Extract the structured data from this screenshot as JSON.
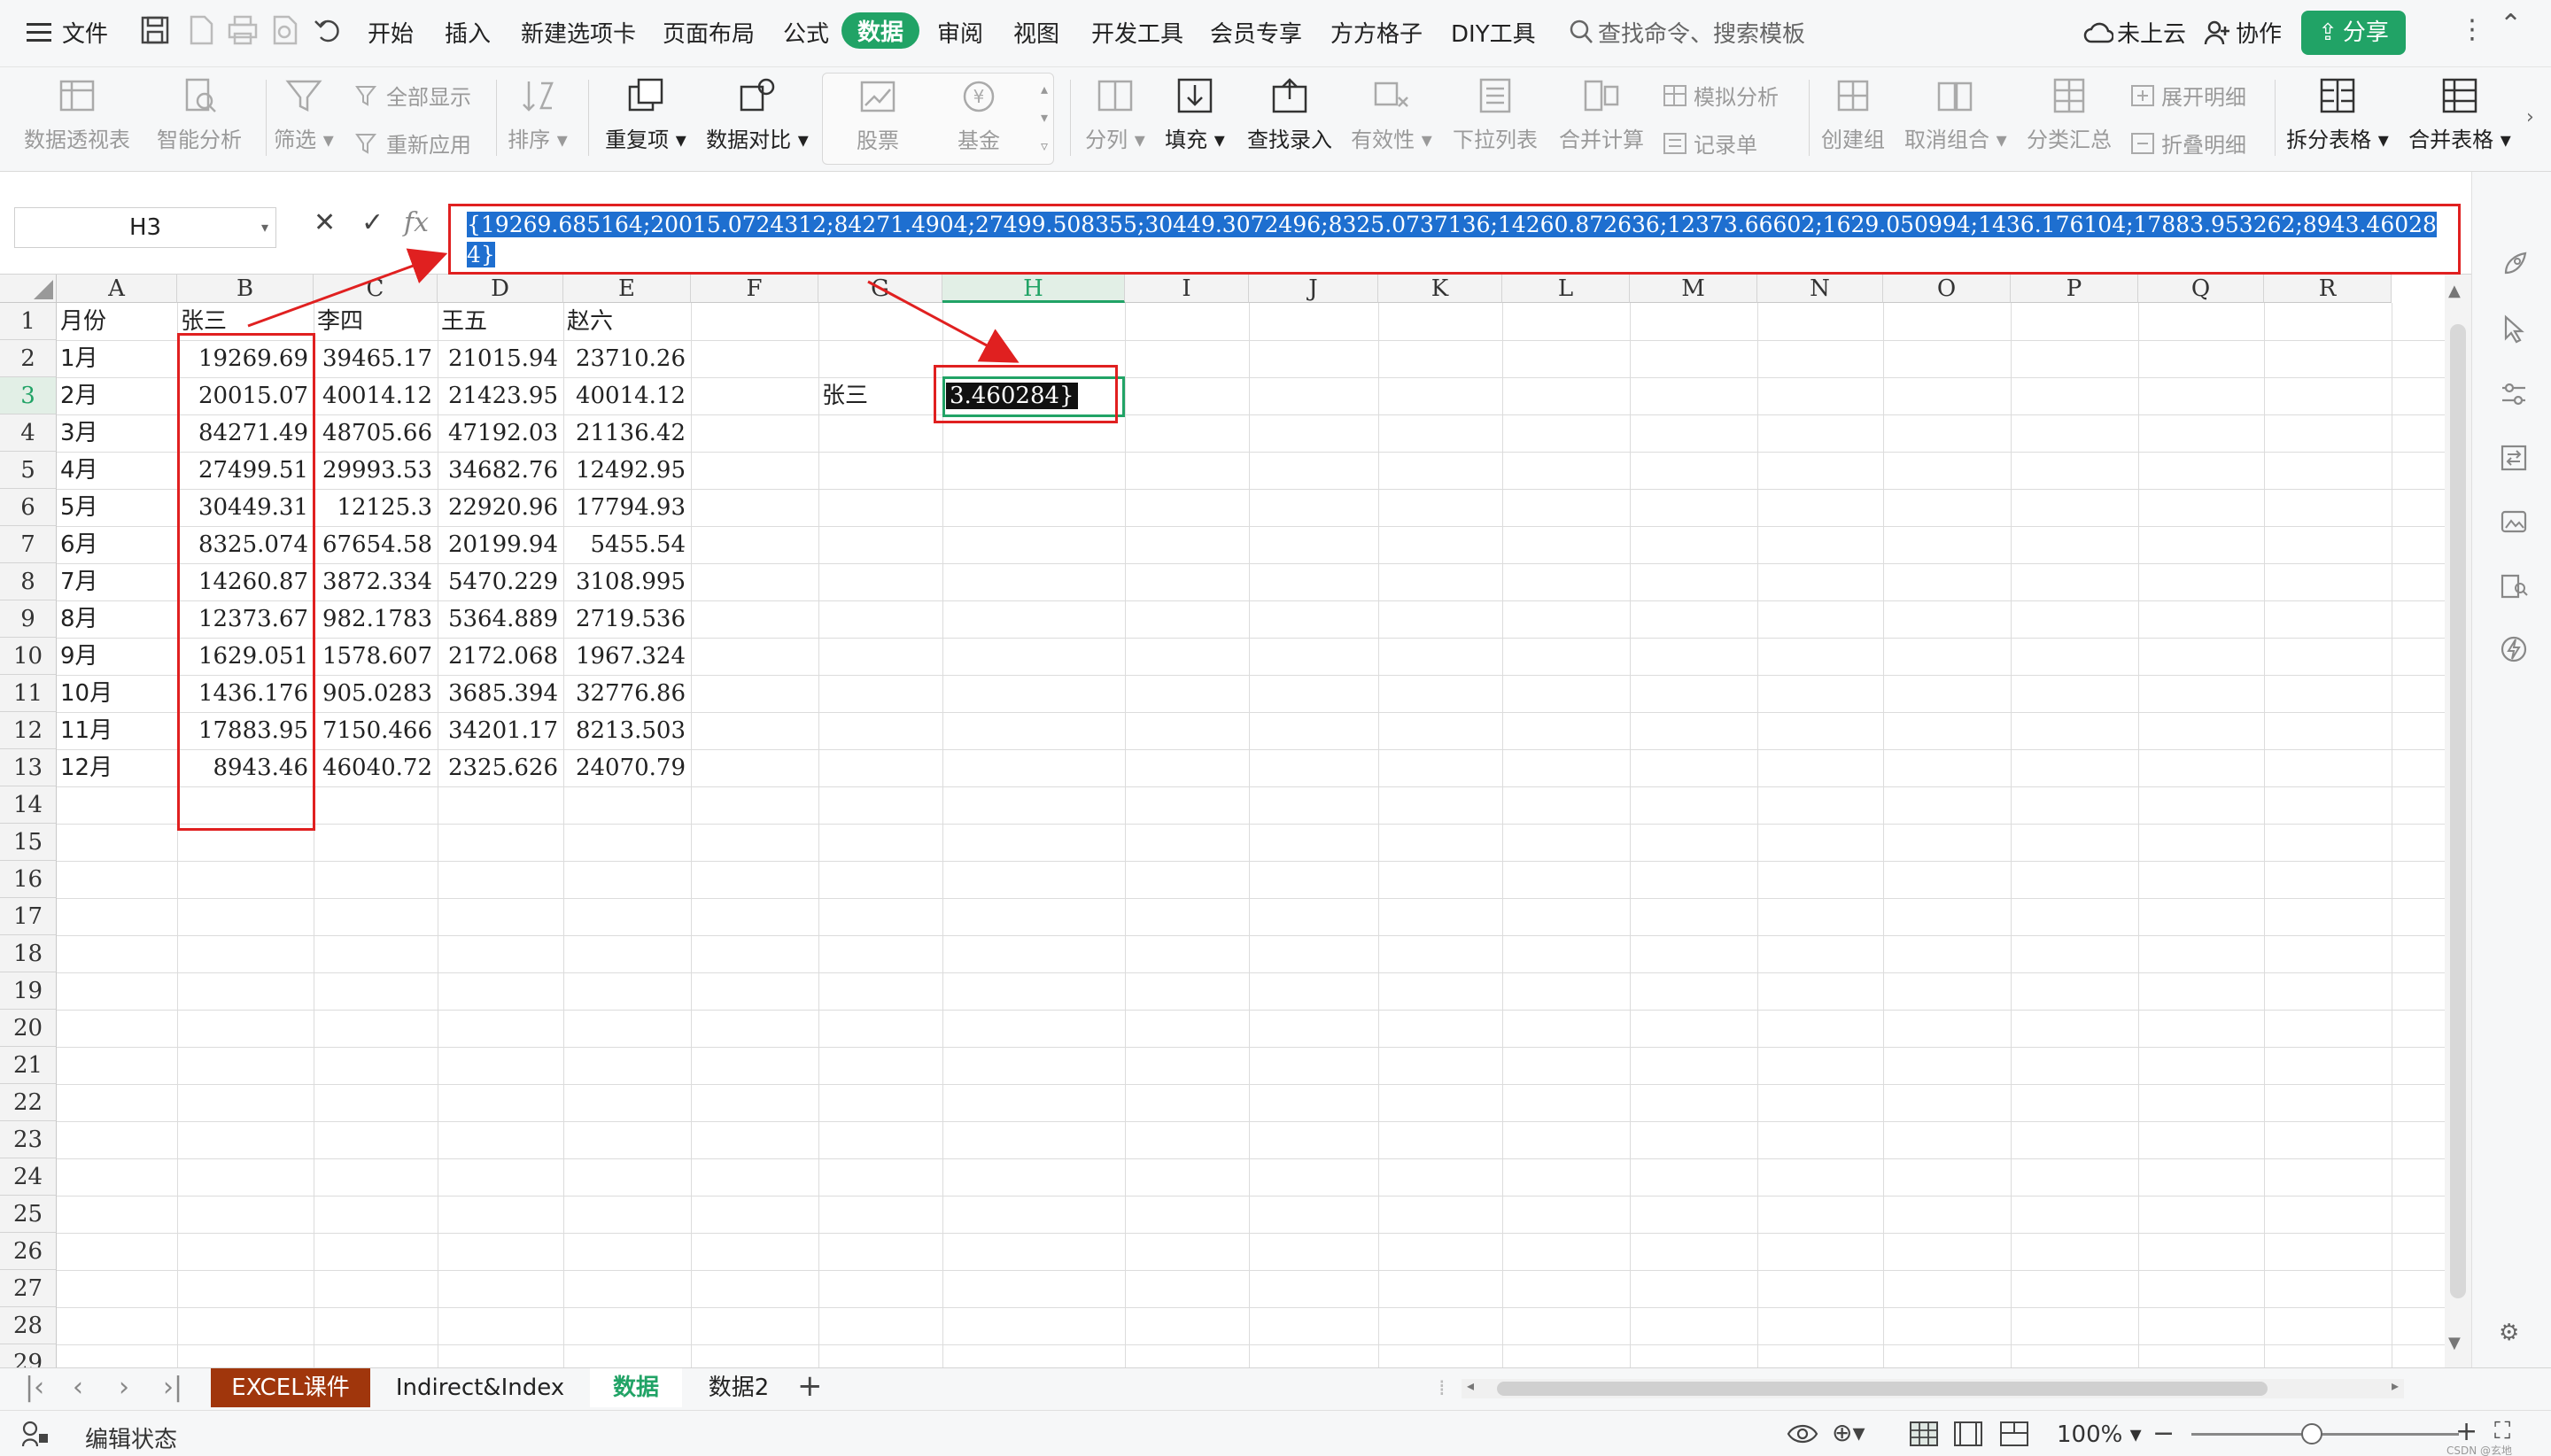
{
  "menubar": {
    "file_label": "文件",
    "tabs": [
      "开始",
      "插入",
      "新建选项卡",
      "页面布局",
      "公式",
      "数据",
      "审阅",
      "视图",
      "开发工具",
      "会员专享",
      "方方格子",
      "DIY工具"
    ],
    "active_tab": "数据",
    "search_placeholder": "查找命令、搜索模板",
    "cloud_label": "未上云",
    "collab_label": "协作",
    "share_label": "分享"
  },
  "ribbon": {
    "pivot": "数据透视表",
    "smart_analysis": "智能分析",
    "filter": "筛选",
    "show_all": "全部显示",
    "reapply": "重新应用",
    "sort": "排序",
    "duplicates": "重复项",
    "compare": "数据对比",
    "stock": "股票",
    "fund": "基金",
    "split_column": "分列",
    "fill": "填充",
    "lookup_entry": "查找录入",
    "validity": "有效性",
    "dropdown_list": "下拉列表",
    "consolidate": "合并计算",
    "whatif": "模拟分析",
    "record_form": "记录单",
    "group": "创建组",
    "ungroup": "取消组合",
    "subtotal": "分类汇总",
    "expand_detail": "展开明细",
    "collapse_detail": "折叠明细",
    "split_table": "拆分表格",
    "merge_table": "合并表格"
  },
  "formula_bar": {
    "name_box": "H3",
    "fx_label": "fx",
    "formula": "{19269.685164;20015.0724312;84271.4904;27499.508355;30449.3072496;8325.0737136;14260.872636;12373.66602;1629.050994;1436.176104;17883.953262;8943.460284}"
  },
  "grid": {
    "columns": [
      "A",
      "B",
      "C",
      "D",
      "E",
      "F",
      "G",
      "H",
      "I",
      "J",
      "K",
      "L",
      "M",
      "N",
      "O",
      "P",
      "Q",
      "R"
    ],
    "row_numbers": [
      "1",
      "2",
      "3",
      "4",
      "5",
      "6",
      "7",
      "8",
      "9",
      "10",
      "11",
      "12",
      "13",
      "14",
      "15",
      "16",
      "17",
      "18",
      "19",
      "20",
      "21",
      "22",
      "23",
      "24",
      "25",
      "26",
      "27",
      "28",
      "29"
    ],
    "header_row": [
      "月份",
      "张三",
      "李四",
      "王五",
      "赵六"
    ],
    "rows": [
      [
        "1月",
        "19269.69",
        "39465.17",
        "21015.94",
        "23710.26"
      ],
      [
        "2月",
        "20015.07",
        "40014.12",
        "21423.95",
        "40014.12"
      ],
      [
        "3月",
        "84271.49",
        "48705.66",
        "47192.03",
        "21136.42"
      ],
      [
        "4月",
        "27499.51",
        "29993.53",
        "34682.76",
        "12492.95"
      ],
      [
        "5月",
        "30449.31",
        "12125.3",
        "22920.96",
        "17794.93"
      ],
      [
        "6月",
        "8325.074",
        "67654.58",
        "20199.94",
        "5455.54"
      ],
      [
        "7月",
        "14260.87",
        "3872.334",
        "5470.229",
        "3108.995"
      ],
      [
        "8月",
        "12373.67",
        "982.1783",
        "5364.889",
        "2719.536"
      ],
      [
        "9月",
        "1629.051",
        "1578.607",
        "2172.068",
        "1967.324"
      ],
      [
        "10月",
        "1436.176",
        "905.0283",
        "3685.394",
        "32776.86"
      ],
      [
        "11月",
        "17883.95",
        "7150.466",
        "34201.17",
        "8213.503"
      ],
      [
        "12月",
        "8943.46",
        "46040.72",
        "2325.626",
        "24070.79"
      ]
    ],
    "g3_label": "张三",
    "h3_edit_text": "3.460284}"
  },
  "sheet_tabs": [
    "EXCEL课件",
    "Indirect&Index",
    "数据",
    "数据2"
  ],
  "active_sheet": "数据",
  "status": {
    "mode": "编辑状态",
    "zoom": "100%",
    "watermark": "CSDN @玄地"
  },
  "colors": {
    "accent": "#21a366",
    "annotation": "#e02020",
    "first_tab": "#a0360c",
    "selection": "#1e6fd0"
  }
}
